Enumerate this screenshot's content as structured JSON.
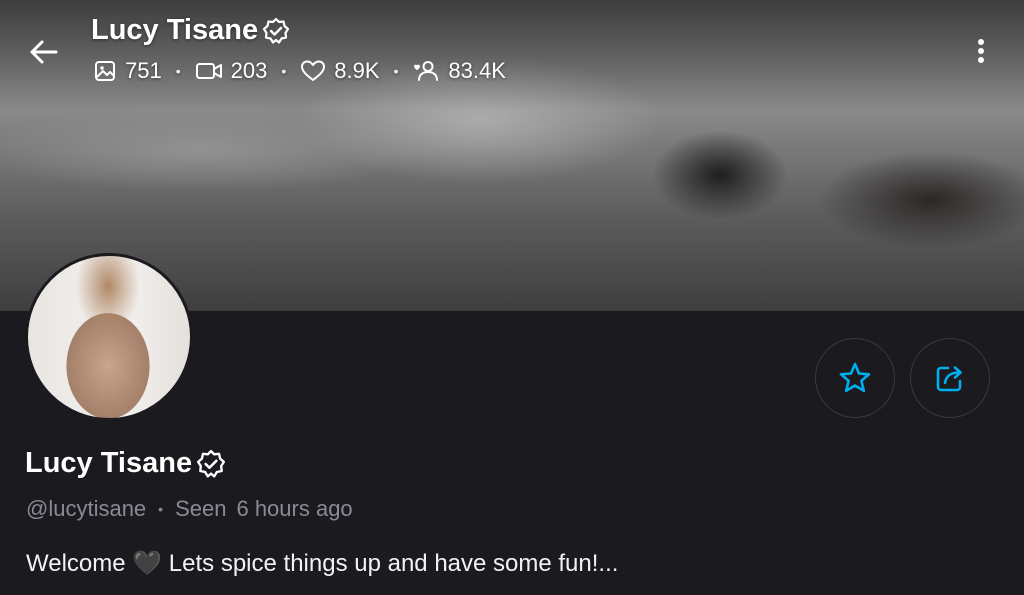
{
  "header": {
    "title": "Lucy Tisane",
    "stats": {
      "photos": "751",
      "videos": "203",
      "likes": "8.9K",
      "fans": "83.4K"
    }
  },
  "profile": {
    "name": "Lucy Tisane",
    "handle": "@lucytisane",
    "seen_label": "Seen",
    "seen_value": "6 hours ago",
    "bio": "Welcome 🖤 Lets spice things up and have some fun!..."
  },
  "icons": {
    "back": "arrow-left-icon",
    "verified": "verified-badge-icon",
    "photos": "image-icon",
    "videos": "video-icon",
    "likes": "heart-icon",
    "fans": "users-icon",
    "more": "more-vertical-icon",
    "favorite": "star-icon",
    "share": "share-icon"
  },
  "colors": {
    "background": "#1b1a1f",
    "accent": "#00aff0",
    "muted_text": "#8a8a96"
  }
}
